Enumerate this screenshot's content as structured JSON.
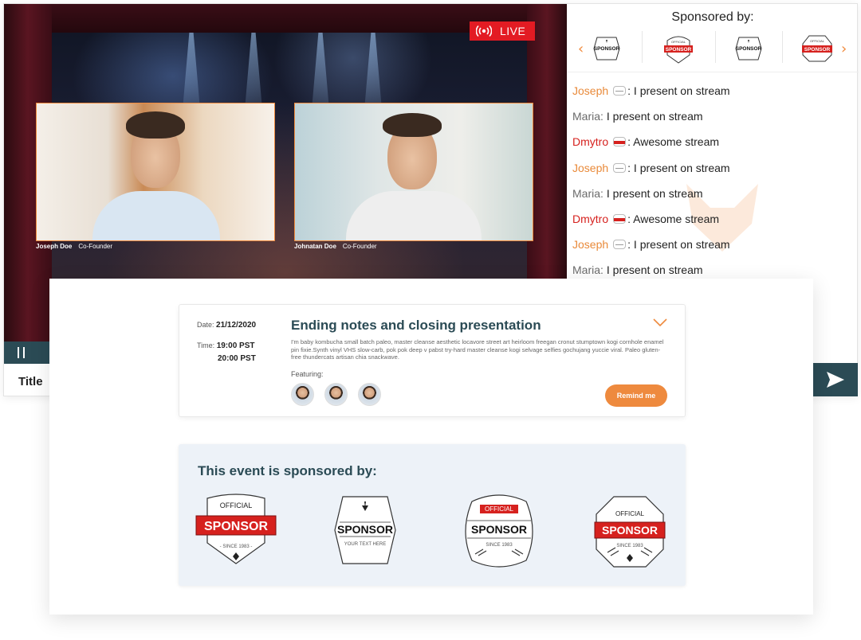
{
  "stream": {
    "live_label": "LIVE",
    "title": "Title",
    "participants": [
      {
        "name": "Joseph Doe",
        "role": "Co-Founder"
      },
      {
        "name": "Johnatan Doe",
        "role": "Co-Founder"
      }
    ]
  },
  "sidebar": {
    "sponsored_heading": "Sponsored by:",
    "prev_arrow": "‹",
    "next_arrow": "›"
  },
  "chat": [
    {
      "name": "Joseph",
      "badge": "plain",
      "color": "orange",
      "text": ": I present on stream"
    },
    {
      "name": "Maria:",
      "badge": "none",
      "color": "gray",
      "text": "I present on stream"
    },
    {
      "name": "Dmytro",
      "badge": "red",
      "color": "red",
      "text": ": Awesome stream"
    },
    {
      "name": "Joseph",
      "badge": "plain",
      "color": "orange",
      "text": ": I present on stream"
    },
    {
      "name": "Maria:",
      "badge": "none",
      "color": "gray",
      "text": "I present on stream"
    },
    {
      "name": "Dmytro",
      "badge": "red",
      "color": "red",
      "text": ": Awesome stream"
    },
    {
      "name": "Joseph",
      "badge": "plain",
      "color": "orange",
      "text": ": I present on stream"
    },
    {
      "name": "Maria:",
      "badge": "none",
      "color": "gray",
      "text": "I present on stream"
    }
  ],
  "event": {
    "date_label": "Date:",
    "date_value": "21/12/2020",
    "time_label": "Time:",
    "time_start": "19:00 PST",
    "time_end": "20:00 PST",
    "title": "Ending notes and closing presentation",
    "description": "I'm baby kombucha small batch paleo, master cleanse aesthetic locavore street art heirloom freegan cronut stumptown kogi cornhole enamel pin fixie.Synth vinyl VHS slow-carb, pok pok deep v pabst try-hard master cleanse kogi selvage selfies gochujang yuccie viral. Paleo gluten-free thundercats artisan chia snackwave.",
    "featuring_label": "Featuring:",
    "remind_label": "Remind me"
  },
  "sponsors_section": {
    "title": "This event is sponsored by:",
    "logos": [
      {
        "top": "OFFICIAL",
        "main": "SPONSOR",
        "bottom": "- SINCE 1983 -"
      },
      {
        "top": "",
        "main": "SPONSOR",
        "bottom": "YOUR TEXT HERE"
      },
      {
        "top": "OFFICIAL",
        "main": "SPONSOR",
        "bottom": "SINCE 1983"
      },
      {
        "top": "OFFICIAL",
        "main": "SPONSOR",
        "bottom": "SINCE 1983"
      }
    ]
  },
  "colors": {
    "accent_orange": "#ee8a3e",
    "brand_teal": "#2b4b55",
    "live_red": "#e31b23"
  }
}
